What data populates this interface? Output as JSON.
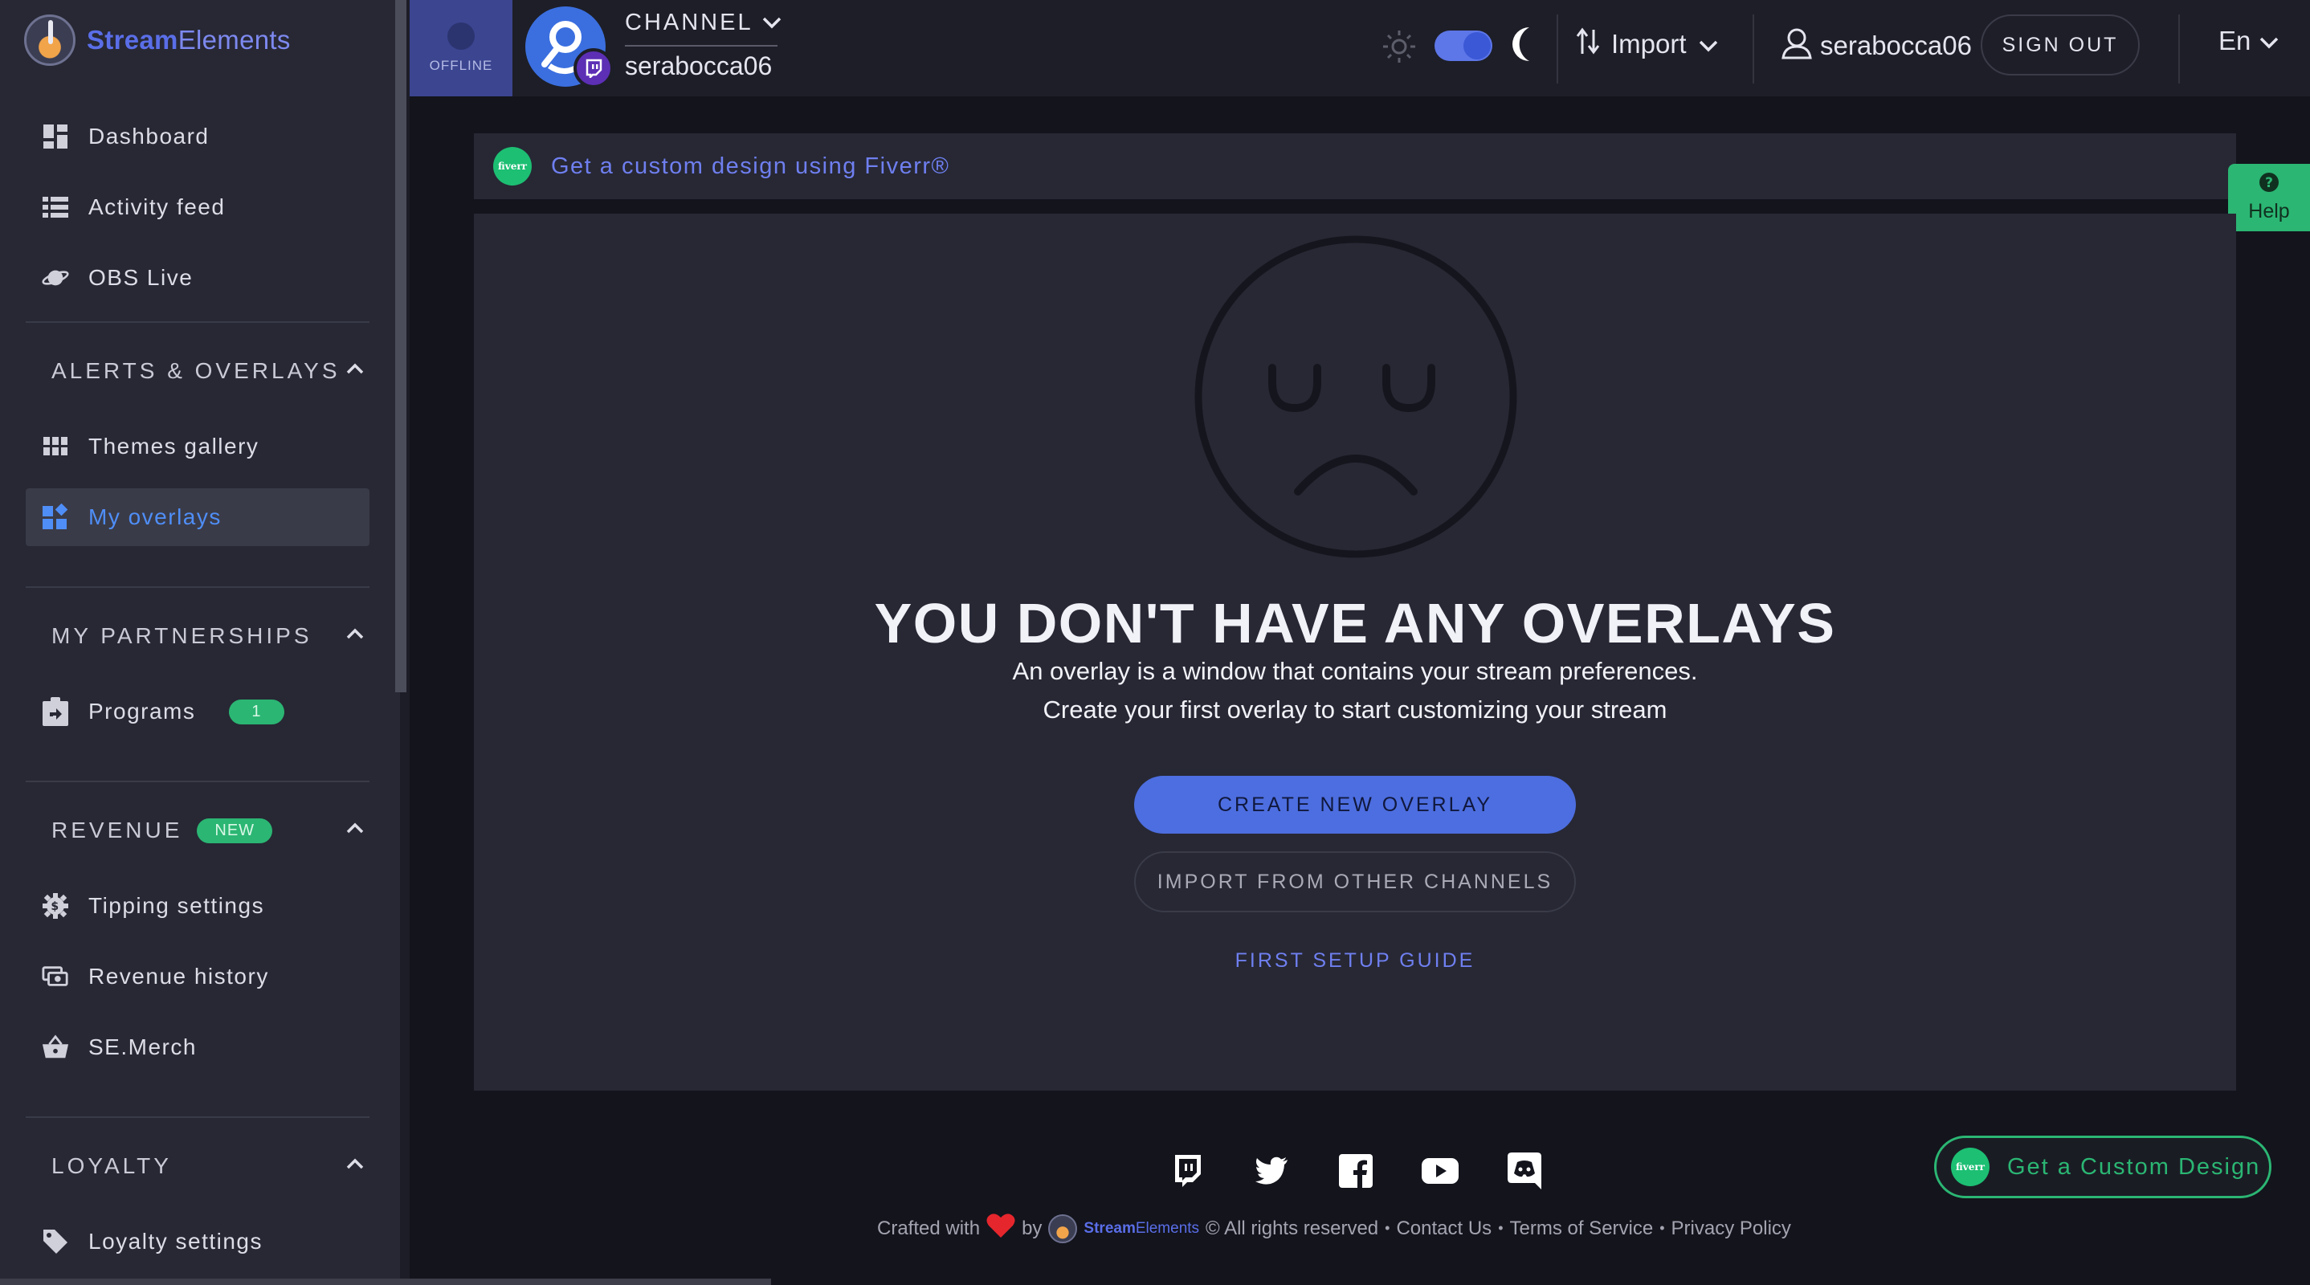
{
  "brand": {
    "name_bold": "Stream",
    "name_regular": "Elements"
  },
  "sidebar": {
    "items": [
      {
        "label": "Dashboard",
        "icon": "dashboard-icon"
      },
      {
        "label": "Activity feed",
        "icon": "list-icon"
      },
      {
        "label": "OBS Live",
        "icon": "planet-icon"
      }
    ],
    "sections": {
      "alerts": {
        "title": "ALERTS & OVERLAYS",
        "items": [
          {
            "label": "Themes gallery",
            "icon": "grid-icon"
          },
          {
            "label": "My overlays",
            "icon": "widgets-icon",
            "active": true
          }
        ]
      },
      "partnerships": {
        "title": "MY PARTNERSHIPS",
        "items": [
          {
            "label": "Programs",
            "icon": "share-icon",
            "badge": "1"
          }
        ]
      },
      "revenue": {
        "title": "REVENUE",
        "badge": "NEW",
        "items": [
          {
            "label": "Tipping settings",
            "icon": "gear-dollar-icon"
          },
          {
            "label": "Revenue history",
            "icon": "money-icon"
          },
          {
            "label": "SE.Merch",
            "icon": "basket-icon"
          }
        ]
      },
      "loyalty": {
        "title": "LOYALTY",
        "items": [
          {
            "label": "Loyalty settings",
            "icon": "tag-icon"
          }
        ]
      }
    }
  },
  "topbar": {
    "status": "OFFLINE",
    "channel_label": "CHANNEL",
    "channel_name": "serabocca06",
    "import_label": "Import",
    "username": "serabocca06",
    "sign_out": "SIGN OUT",
    "language": "En",
    "dark_mode": true
  },
  "banner": {
    "fiverr_logo_text": "fiverr",
    "text": "Get a custom design using Fiverr®"
  },
  "help": {
    "label": "Help"
  },
  "empty_state": {
    "title": "YOU DON'T HAVE ANY OVERLAYS",
    "line1": "An overlay is a window that contains your stream preferences.",
    "line2": "Create your first overlay to start customizing your stream",
    "create_button": "CREATE NEW OVERLAY",
    "import_button": "IMPORT FROM OTHER CHANNELS",
    "guide_link": "FIRST SETUP GUIDE"
  },
  "footer": {
    "crafted_with": "Crafted with",
    "by": "by",
    "brand_bold": "Stream",
    "brand_regular": "Elements",
    "rights": "© All rights reserved",
    "links": [
      "Contact Us",
      "Terms of Service",
      "Privacy Policy"
    ],
    "socials": [
      "twitch-icon",
      "twitter-icon",
      "facebook-icon",
      "youtube-icon",
      "discord-icon"
    ]
  },
  "custom_design": {
    "logo_text": "fiverr",
    "label": "Get a Custom Design"
  },
  "colors": {
    "accent": "#4d6ee0",
    "link": "#6f7ff0",
    "green": "#2bb673",
    "active_nav": "#4f8ef7"
  }
}
